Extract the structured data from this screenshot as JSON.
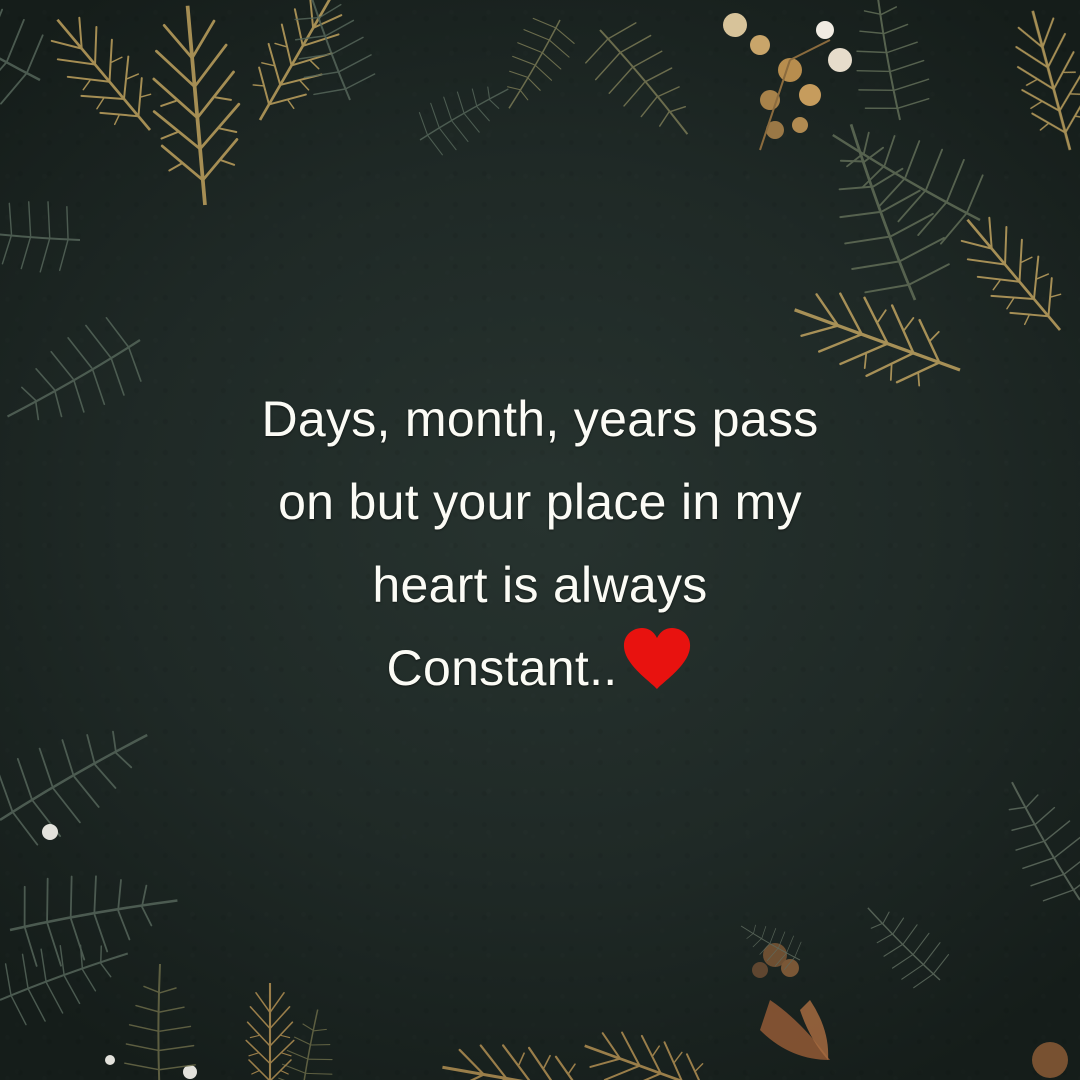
{
  "quote": {
    "line1": "Days, month, years pass",
    "line2": "on but your place in my",
    "line3": "heart is always",
    "line4": "Constant.."
  },
  "icons": {
    "heart": "heart-icon"
  },
  "colors": {
    "background": "#1f2926",
    "text": "#fbfbf5",
    "heart": "#e8120f",
    "foliage_gold": "#b59a5a",
    "foliage_dark": "#4a5a4e"
  }
}
